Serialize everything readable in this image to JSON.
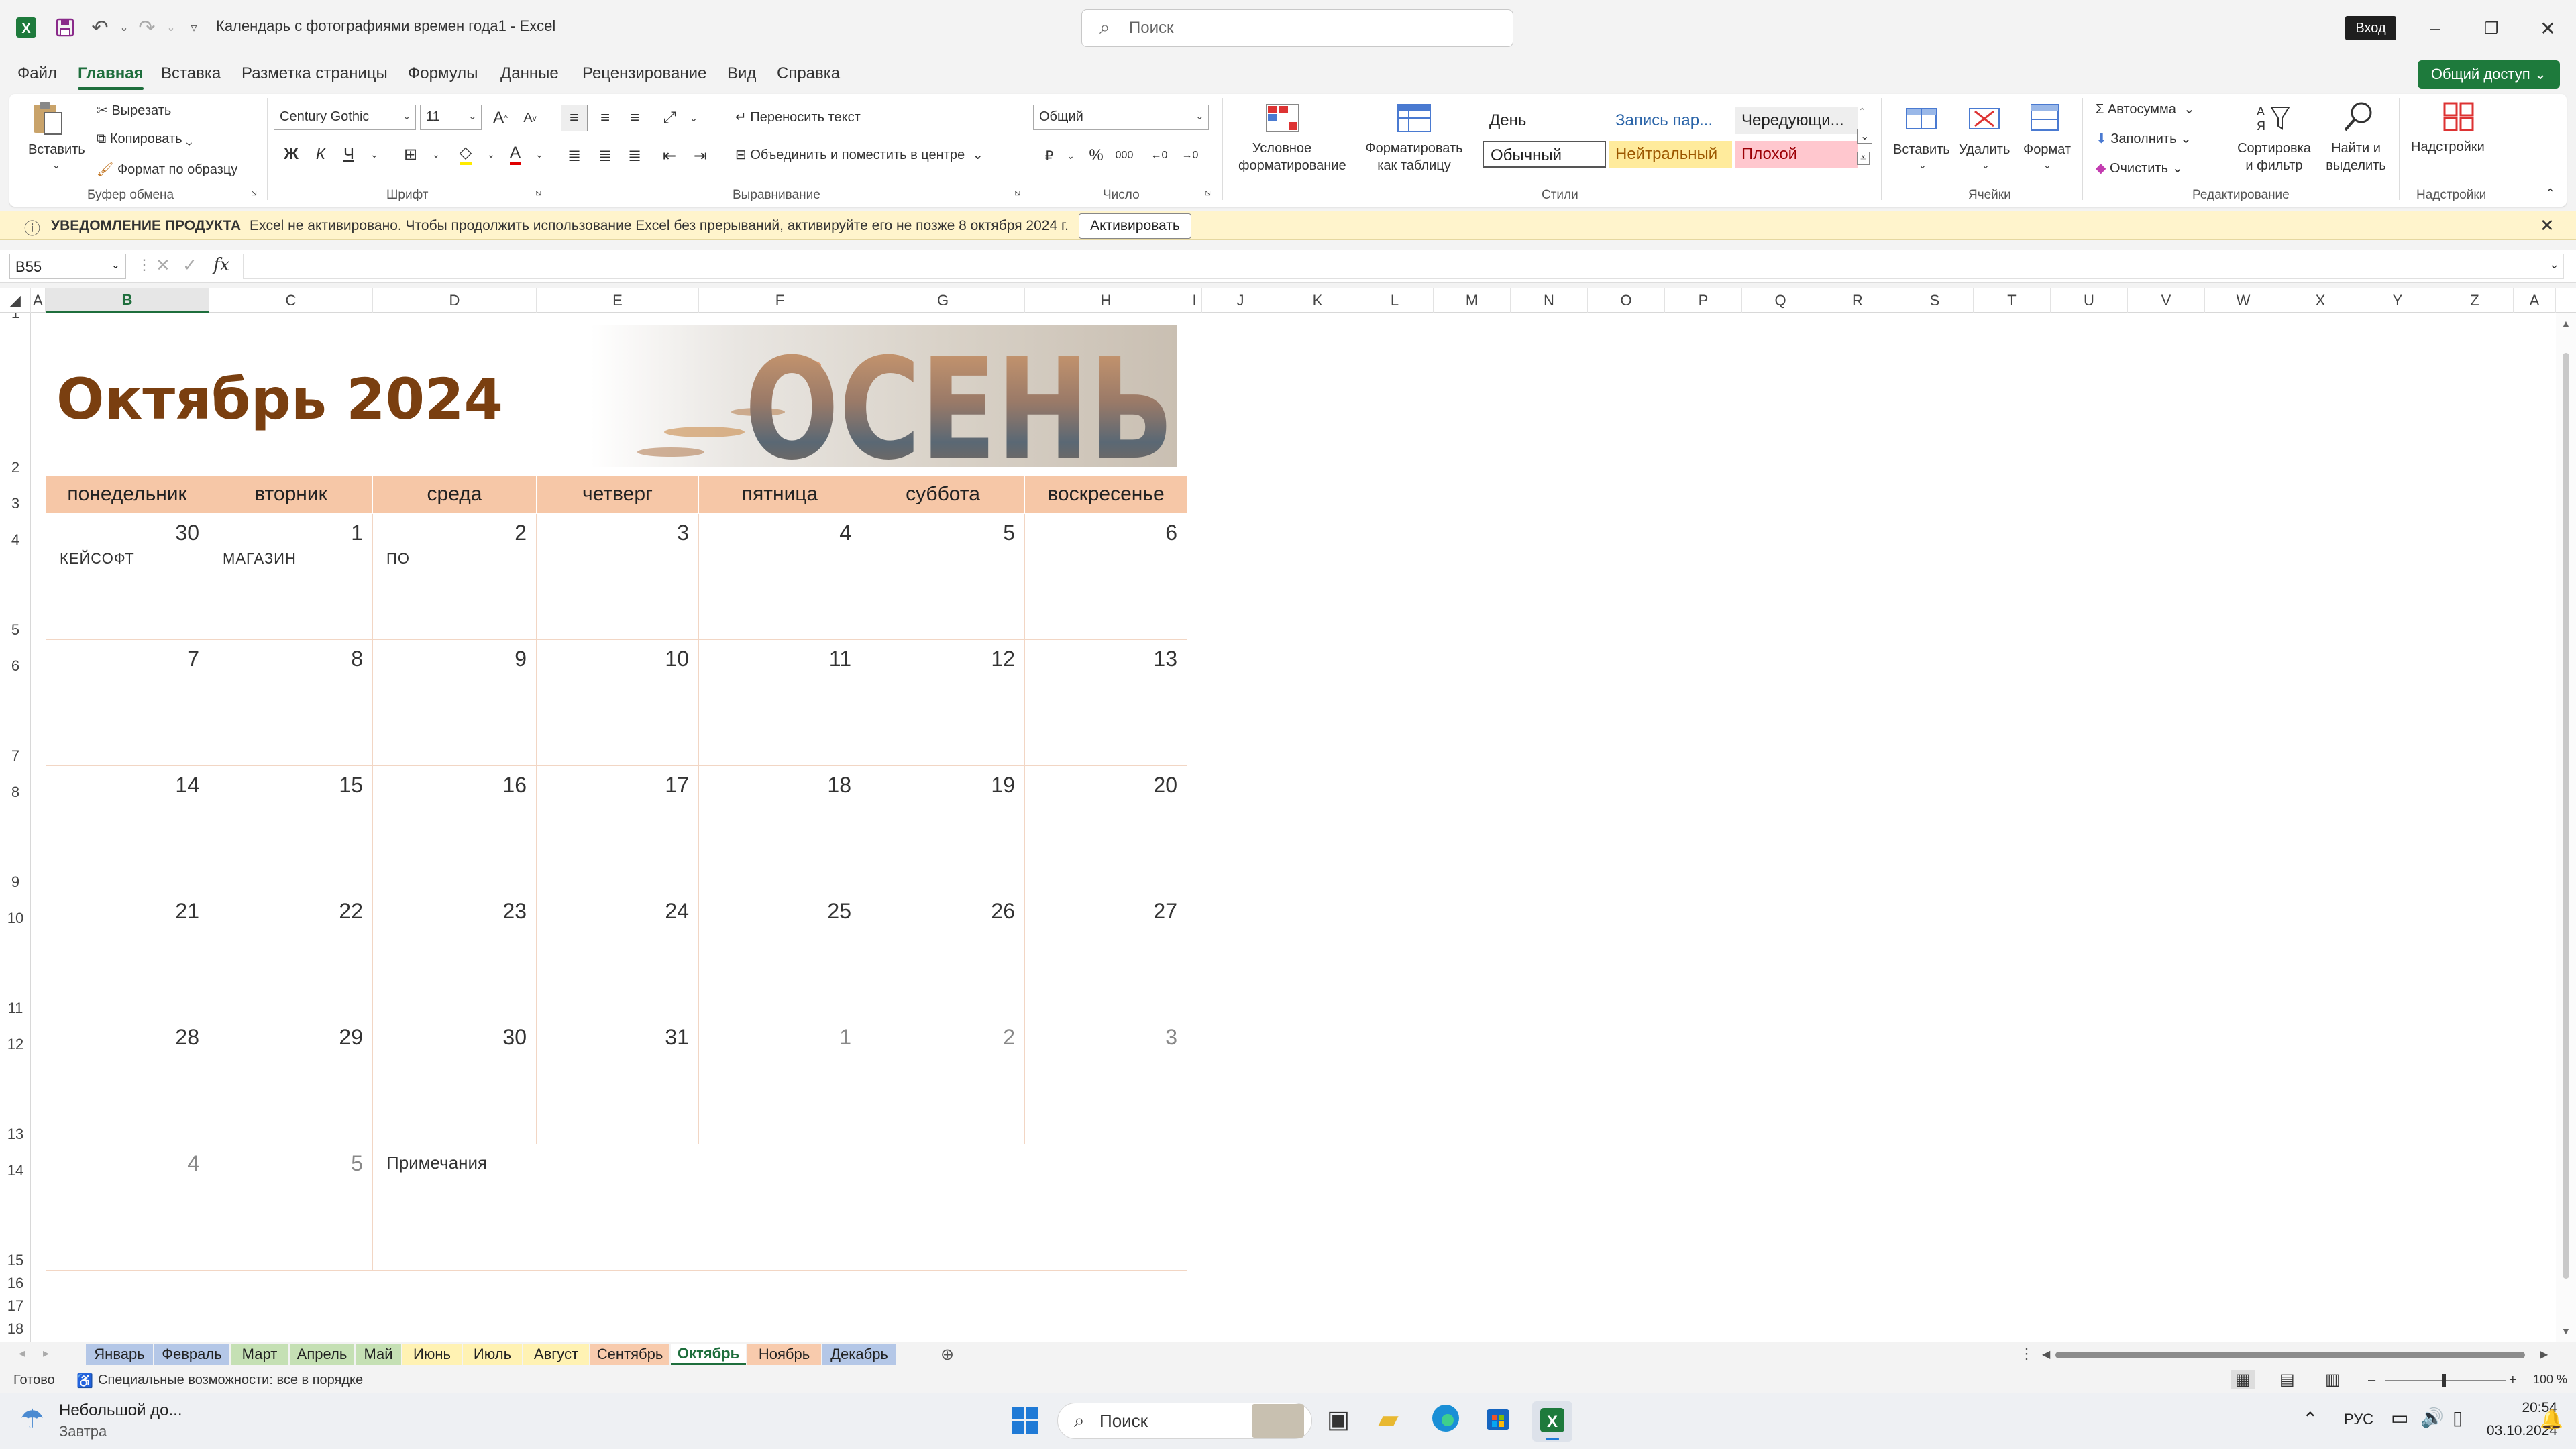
{
  "window": {
    "title": "Календарь с фотографиями времен года1  -  Excel",
    "search_placeholder": "Поиск",
    "signin": "Вход"
  },
  "menu": {
    "tabs": [
      "Файл",
      "Главная",
      "Вставка",
      "Разметка страницы",
      "Формулы",
      "Данные",
      "Рецензирование",
      "Вид",
      "Справка"
    ],
    "share": "Общий доступ"
  },
  "ribbon": {
    "clipboard": {
      "paste": "Вставить",
      "cut": "Вырезать",
      "copy": "Копировать",
      "format_painter": "Формат по образцу",
      "group": "Буфер обмена"
    },
    "font": {
      "family": "Century Gothic",
      "size": "11",
      "bold": "Ж",
      "italic": "К",
      "underline": "Ч",
      "group": "Шрифт"
    },
    "alignment": {
      "wrap": "Переносить текст",
      "merge": "Объединить и поместить в центре",
      "group": "Выравнивание"
    },
    "number": {
      "format": "Общий",
      "group": "Число"
    },
    "styles": {
      "conditional": "Условное форматирование",
      "as_table": "Форматировать как таблицу",
      "day": "День",
      "record": "Запись пар...",
      "alt": "Чередующи...",
      "normal": "Обычный",
      "neutral": "Нейтральный",
      "bad": "Плохой",
      "group": "Стили"
    },
    "cells": {
      "insert": "Вставить",
      "delete": "Удалить",
      "format": "Формат",
      "group": "Ячейки"
    },
    "editing": {
      "autosum": "Автосумма",
      "fill": "Заполнить",
      "clear": "Очистить",
      "sort": "Сортировка и фильтр",
      "find": "Найти и выделить",
      "group": "Редактирование"
    },
    "addins": {
      "label": "Надстройки",
      "group": "Надстройки"
    }
  },
  "notification": {
    "title": "УВЕДОМЛЕНИЕ ПРОДУКТА",
    "text": "Excel не активировано. Чтобы продолжить использование Excel без прерываний, активируйте его не позже 8 октября 2024 г.",
    "button": "Активировать"
  },
  "formula_bar": {
    "name_box": "B55",
    "fx": "fx",
    "value": ""
  },
  "columns": [
    "A",
    "B",
    "C",
    "D",
    "E",
    "F",
    "G",
    "H",
    "I",
    "J",
    "K",
    "L",
    "M",
    "N",
    "O",
    "P",
    "Q",
    "R",
    "S",
    "T",
    "U",
    "V",
    "W",
    "X",
    "Y",
    "Z",
    "A"
  ],
  "calendar": {
    "title": "Октябрь 2024",
    "banner_text": "ОСЕНЬ",
    "weekdays": [
      "понедельник",
      "вторник",
      "среда",
      "четверг",
      "пятница",
      "суббота",
      "воскресенье"
    ],
    "weeks": [
      [
        {
          "d": "30",
          "dim": false,
          "note": "КЕЙСОФТ"
        },
        {
          "d": "1",
          "dim": false,
          "note": "МАГАЗИН"
        },
        {
          "d": "2",
          "dim": false,
          "note": "ПО"
        },
        {
          "d": "3"
        },
        {
          "d": "4"
        },
        {
          "d": "5"
        },
        {
          "d": "6"
        }
      ],
      [
        {
          "d": "7"
        },
        {
          "d": "8"
        },
        {
          "d": "9"
        },
        {
          "d": "10"
        },
        {
          "d": "11"
        },
        {
          "d": "12"
        },
        {
          "d": "13"
        }
      ],
      [
        {
          "d": "14"
        },
        {
          "d": "15"
        },
        {
          "d": "16"
        },
        {
          "d": "17"
        },
        {
          "d": "18"
        },
        {
          "d": "19"
        },
        {
          "d": "20"
        }
      ],
      [
        {
          "d": "21"
        },
        {
          "d": "22"
        },
        {
          "d": "23"
        },
        {
          "d": "24"
        },
        {
          "d": "25"
        },
        {
          "d": "26"
        },
        {
          "d": "27"
        }
      ],
      [
        {
          "d": "28"
        },
        {
          "d": "29"
        },
        {
          "d": "30"
        },
        {
          "d": "31"
        },
        {
          "d": "1",
          "dim": true
        },
        {
          "d": "2",
          "dim": true
        },
        {
          "d": "3",
          "dim": true
        }
      ]
    ],
    "last_row": [
      {
        "d": "4",
        "dim": true
      },
      {
        "d": "5",
        "dim": true
      }
    ],
    "notes_label": "Примечания"
  },
  "sheet_tabs": [
    {
      "name": "Январь",
      "color": "#b4c7e7"
    },
    {
      "name": "Февраль",
      "color": "#b4c7e7"
    },
    {
      "name": "Март",
      "color": "#c5e0b4"
    },
    {
      "name": "Апрель",
      "color": "#c5e0b4"
    },
    {
      "name": "Май",
      "color": "#c5e0b4"
    },
    {
      "name": "Июнь",
      "color": "#fff2b3"
    },
    {
      "name": "Июль",
      "color": "#fff2b3"
    },
    {
      "name": "Август",
      "color": "#fff2b3"
    },
    {
      "name": "Сентябрь",
      "color": "#f8cbad"
    },
    {
      "name": "Октябрь",
      "color": "#ffffff",
      "active": true
    },
    {
      "name": "Ноябрь",
      "color": "#f8cbad"
    },
    {
      "name": "Декабрь",
      "color": "#b4c7e7"
    }
  ],
  "status": {
    "ready": "Готово",
    "accessibility": "Специальные возможности: все в порядке",
    "zoom": "100 %"
  },
  "taskbar": {
    "weather_title": "Небольшой до...",
    "weather_sub": "Завтра",
    "search": "Поиск",
    "lang": "РУС",
    "time": "20:54",
    "date": "03.10.2024"
  }
}
